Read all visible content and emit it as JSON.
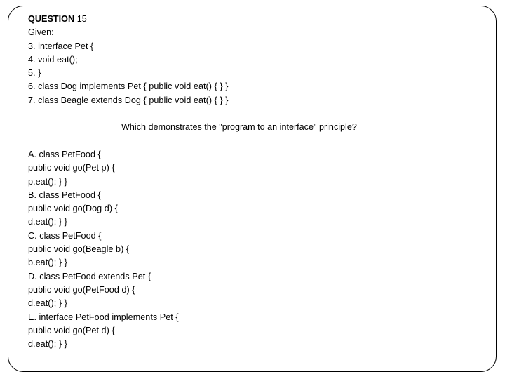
{
  "slide": {
    "header": {
      "label": "QUESTION",
      "number": "15",
      "given_label": "Given:"
    },
    "code_listing": [
      "3. interface Pet {",
      "4. void eat();",
      "5. }",
      "6. class Dog implements Pet { public void eat() { } }",
      "7. class Beagle extends Dog { public void eat() { } }"
    ],
    "prompt": "Which demonstrates the \"program to an interface\" principle?",
    "options": [
      {
        "id": "A",
        "lines": [
          "A. class PetFood {",
          "public void go(Pet p) {",
          "p.eat(); } }"
        ]
      },
      {
        "id": "B",
        "lines": [
          "B. class PetFood {",
          "public void go(Dog d) {",
          "d.eat(); } }"
        ]
      },
      {
        "id": "C",
        "lines": [
          "C. class PetFood {",
          "public void go(Beagle b) {",
          "b.eat(); } }"
        ]
      },
      {
        "id": "D",
        "lines": [
          "D. class PetFood extends Pet {",
          "public void go(PetFood d) {",
          "d.eat(); } }"
        ]
      },
      {
        "id": "E",
        "lines": [
          "E. interface PetFood implements Pet {",
          "public void go(Pet d) {",
          "d.eat(); } }"
        ]
      }
    ],
    "colors": {
      "text": "#000000",
      "background": "#ffffff",
      "border": "#000000"
    }
  }
}
